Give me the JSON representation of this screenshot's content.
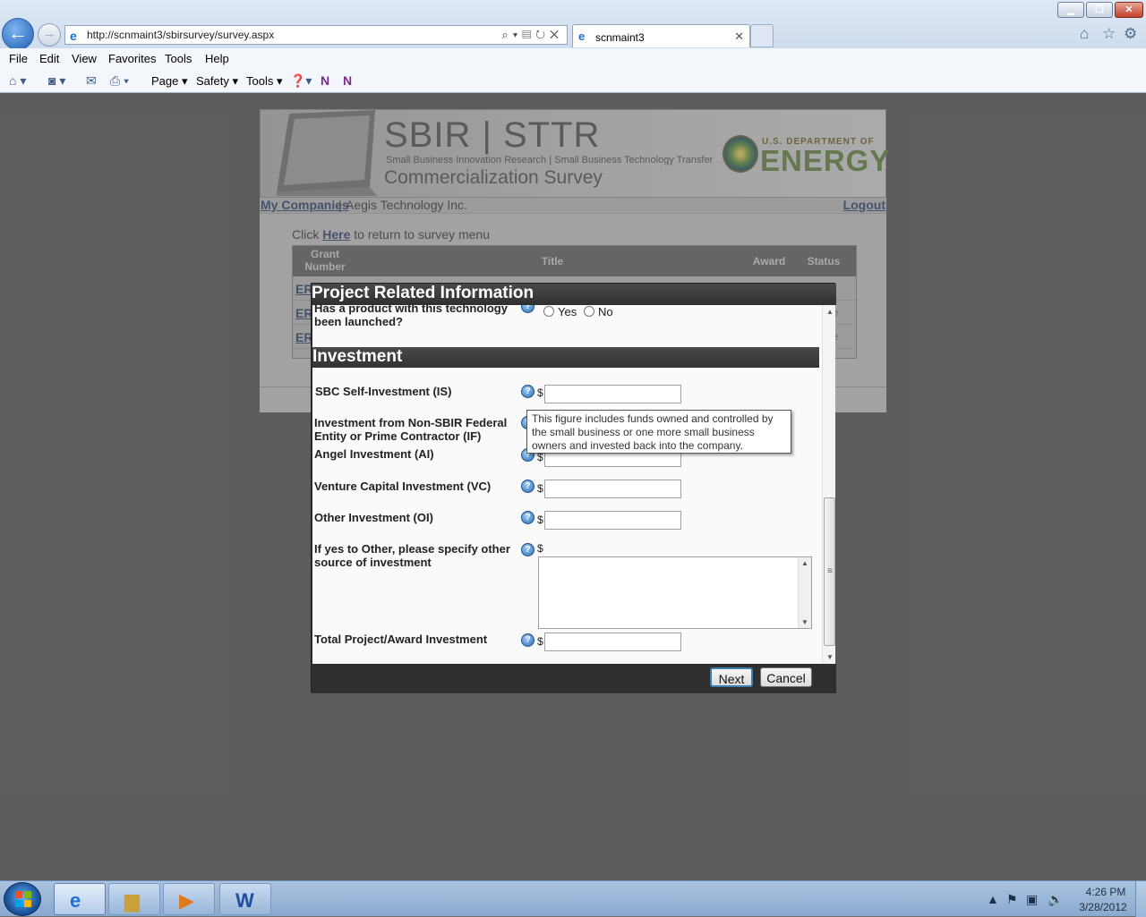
{
  "browser": {
    "url": "http://scnmaint3/sbirsurvey/survey.aspx",
    "tab_title": "scnmaint3",
    "menu": [
      "File",
      "Edit",
      "View",
      "Favorites",
      "Tools",
      "Help"
    ],
    "commands": {
      "page": "Page",
      "safety": "Safety",
      "tools": "Tools"
    }
  },
  "site": {
    "brand_title": "SBIR | STTR",
    "brand_subtitle": "Small Business Innovation Research | Small Business Technology Transfer",
    "brand_survey": "Commercialization Survey",
    "doe_sub": "U.S. DEPARTMENT OF",
    "doe_main": "ENERGY",
    "my_companies": "My Companies",
    "separator": "|",
    "company": "Aegis Technology Inc.",
    "logout": "Logout",
    "return_prefix": "Click",
    "return_link": "Here",
    "return_suffix": "to return to survey menu",
    "grid": {
      "headers": [
        "Grant Number",
        "Title",
        "Award",
        "Status"
      ],
      "rows": [
        {
          "grant": "ER",
          "status": "ete"
        },
        {
          "grant": "ER",
          "status": "lete"
        },
        {
          "grant": "ER",
          "status": "lete"
        }
      ]
    }
  },
  "modal": {
    "title": "Project Related Information",
    "launch_question": "Has a product with this technology been launched?",
    "yes": "Yes",
    "no": "No",
    "section": "Investment",
    "currency": "$",
    "fields": [
      {
        "label": "SBC Self-Investment (IS)",
        "value": ""
      },
      {
        "label": "Investment from Non-SBIR Federal Entity or Prime Contractor (IF)",
        "value": ""
      },
      {
        "label": "Angel Investment (AI)",
        "value": ""
      },
      {
        "label": "Venture Capital Investment (VC)",
        "value": ""
      },
      {
        "label": "Other Investment (OI)",
        "value": ""
      },
      {
        "label": "If yes to Other, please specify other source of investment",
        "value": ""
      },
      {
        "label": "Total Project/Award Investment",
        "value": ""
      }
    ],
    "tooltip": "This figure includes funds owned and controlled by the small business or one more small business owners and invested back into the company.",
    "next": "Next",
    "cancel": "Cancel"
  },
  "taskbar": {
    "time": "4:26 PM",
    "date": "3/28/2012"
  },
  "icons": {
    "back": "back-arrow-icon",
    "forward": "forward-arrow-icon",
    "favicon": "ie-favicon-icon",
    "home": "home-icon",
    "favorites": "star-icon",
    "settings": "gear-icon",
    "help": "question-icon"
  }
}
